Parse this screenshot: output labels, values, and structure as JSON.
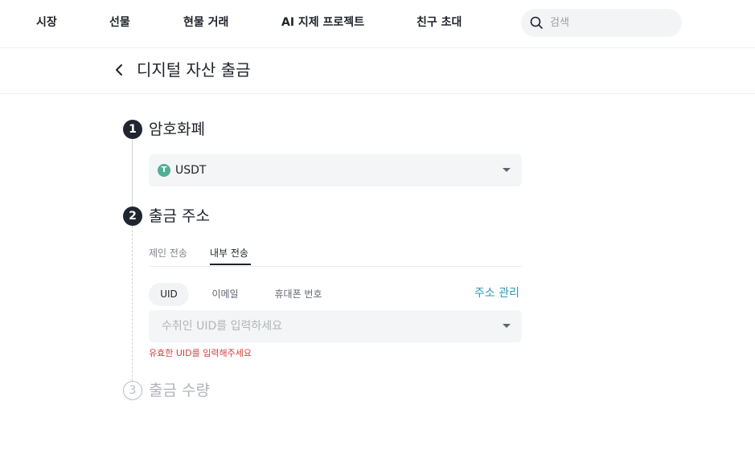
{
  "nav": {
    "items": [
      {
        "label": "시장"
      },
      {
        "label": "선물"
      },
      {
        "label": "현물 거래"
      },
      {
        "label": "AI 지제 프로젝트"
      },
      {
        "label": "친구 초대"
      }
    ],
    "search_placeholder": "검색",
    "search_icon": "search-icon"
  },
  "header": {
    "back_icon": "chevron-left-icon",
    "title": "디지털 자산 출금"
  },
  "steps": [
    {
      "number": "1",
      "title": "암호화폐",
      "state": "active"
    },
    {
      "number": "2",
      "title": "출금 주소",
      "state": "active"
    },
    {
      "number": "3",
      "title": "출금 수량",
      "state": "inactive"
    }
  ],
  "coin_select": {
    "value": "USDT",
    "icon_letter": "T",
    "icon_color": "#50af95"
  },
  "address": {
    "tabs": [
      {
        "label": "제인 전송",
        "active": false
      },
      {
        "label": "내부 전송",
        "active": true
      }
    ],
    "methods": [
      {
        "label": "UID",
        "active": true
      },
      {
        "label": "이메일",
        "active": false
      },
      {
        "label": "휴대폰 번호",
        "active": false
      }
    ],
    "manage_label": "주소 관리",
    "uid_placeholder": "수취인 UID를 입력하세요",
    "error": "유효한 UID를 입력해주세요"
  },
  "colors": {
    "accent_link": "#2a9bb5",
    "error": "#d23f3f",
    "step_active": "#202630"
  }
}
